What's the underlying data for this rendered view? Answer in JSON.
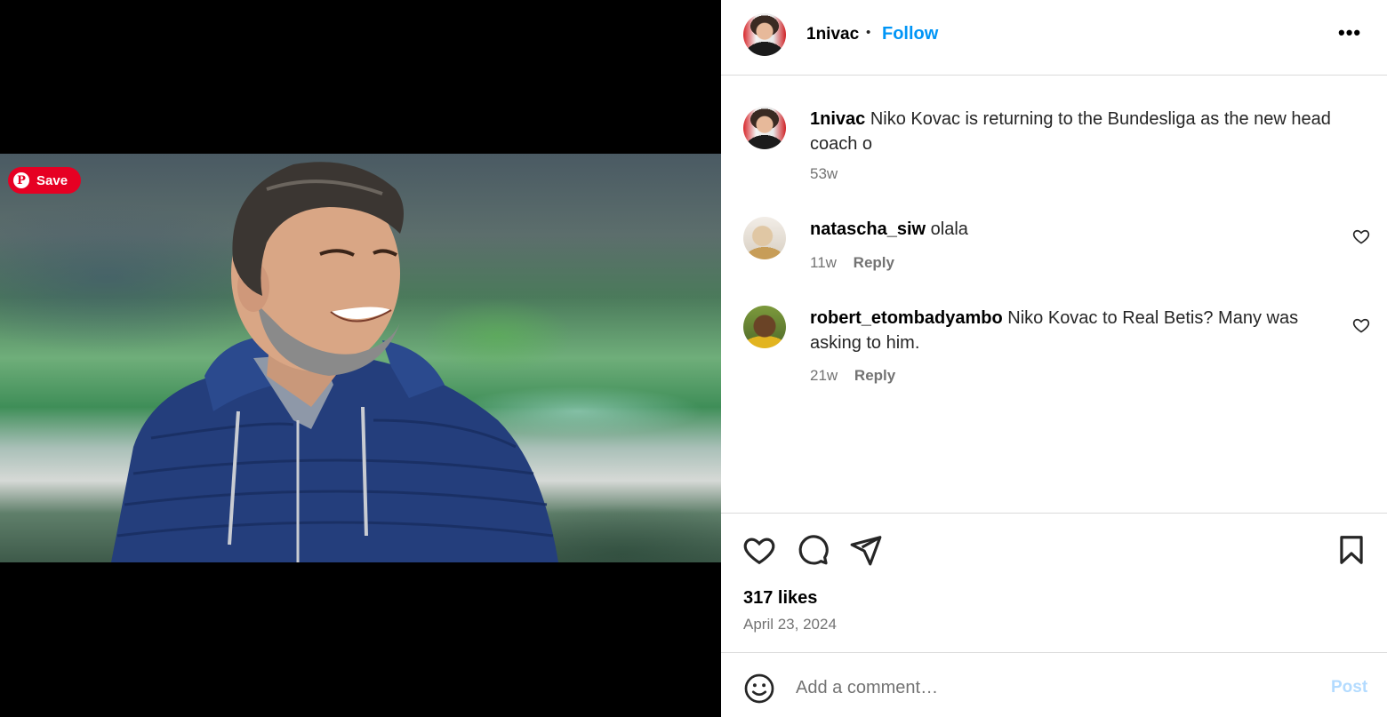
{
  "media": {
    "save_label": "Save",
    "pin_glyph": "P"
  },
  "header": {
    "username": "1nivac",
    "separator": "•",
    "follow_label": "Follow",
    "more_glyph": "•••"
  },
  "caption": {
    "username": "1nivac",
    "text": "Niko Kovac is returning to the Bundesliga as the new head coach o",
    "time": "53w"
  },
  "comments": [
    {
      "username": "natascha_siw",
      "text": "olala",
      "time": "11w",
      "reply_label": "Reply"
    },
    {
      "username": "robert_etombadyambo",
      "text": "Niko Kovac to Real Betis? Many was asking to him.",
      "time": "21w",
      "reply_label": "Reply"
    }
  ],
  "actions": {
    "icons": [
      "heart-icon",
      "comment-icon",
      "share-icon",
      "bookmark-icon"
    ],
    "likes": "317 likes",
    "date": "April 23, 2024"
  },
  "add_comment": {
    "placeholder": "Add a comment…",
    "post_label": "Post"
  },
  "colors": {
    "follow": "#0095f6",
    "post_disabled": "#b3dbff",
    "pinterest": "#e60023",
    "muted": "#737373"
  }
}
